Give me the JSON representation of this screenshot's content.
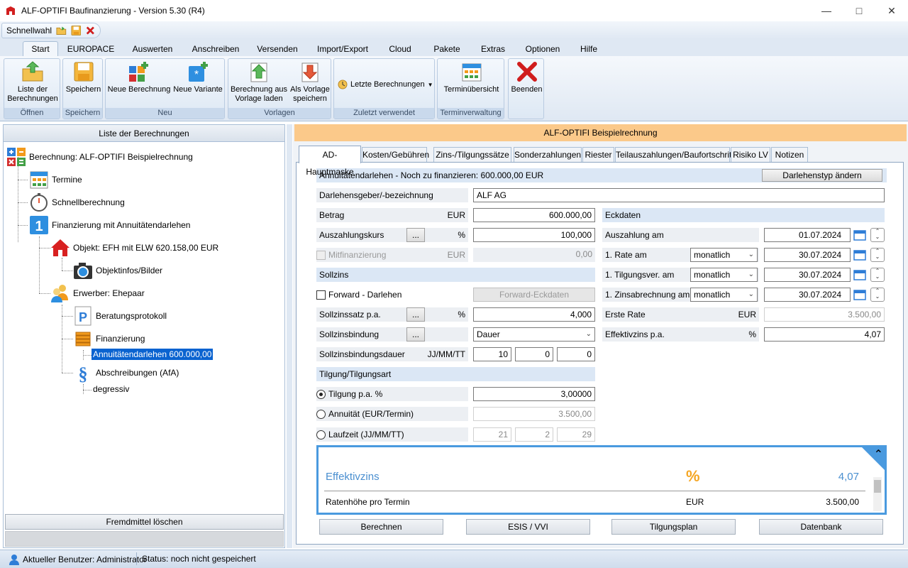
{
  "window": {
    "title": "ALF-OPTIFI Baufinanzierung - Version 5.30 (R4)"
  },
  "quick_access": {
    "label": "Schnellwahl"
  },
  "ribbon_tabs": [
    "Start",
    "EUROPACE",
    "Auswerten",
    "Anschreiben",
    "Versenden",
    "Import/Export",
    "Cloud",
    "Pakete",
    "Extras",
    "Optionen",
    "Hilfe"
  ],
  "ribbon": {
    "groups": {
      "oeffnen": "Öffnen",
      "speichern": "Speichern",
      "neu": "Neu",
      "vorlagen": "Vorlagen",
      "zuletzt": "Zuletzt verwendet",
      "termin": "Terminverwaltung"
    },
    "buttons": {
      "liste": "Liste der Berechnungen",
      "speichern": "Speichern",
      "neue_berechnung": "Neue Berechnung",
      "neue_variante": "Neue Variante",
      "vorlage_laden": "Berechnung aus Vorlage laden",
      "vorlage_speichern": "Als Vorlage speichern",
      "letzte": "Letzte Berechnungen",
      "termin": "Terminübersicht",
      "beenden": "Beenden"
    }
  },
  "left": {
    "header": "Liste der Berechnungen",
    "tree": {
      "root": "Berechnung: ALF-OPTIFI Beispielrechnung",
      "termine": "Termine",
      "schnell": "Schnellberechnung",
      "finanzierung": "Finanzierung mit Annuitätendarlehen",
      "objekt": "Objekt: EFH mit ELW 620.158,00 EUR",
      "objektinfos": "Objektinfos/Bilder",
      "erwerber": "Erwerber: Ehepaar",
      "beratung": "Beratungsprotokoll",
      "fin": "Finanzierung",
      "annuitaet": "Annuitätendarlehen 600.000,00",
      "afa": "Abschreibungen (AfA)",
      "degressiv": "degressiv"
    },
    "btn_fremdmittel": "Fremdmittel löschen"
  },
  "right": {
    "header": "ALF-OPTIFI Beispielrechnung",
    "tabs": [
      "AD-Hauptmaske",
      "Kosten/Gebühren",
      "Zins-/Tilgungssätze",
      "Sonderzahlungen",
      "Riester",
      "Teilauszahlungen/Baufortschritt",
      "Risiko LV",
      "Notizen"
    ],
    "form": {
      "top_section": "Annuitätendarlehen - Noch zu finanzieren:  600.000,00 EUR",
      "btn_darlehenstyp": "Darlehenstyp ändern",
      "darlehensgeber_label": "Darlehensgeber/-bezeichnung",
      "darlehensgeber_value": "ALF AG",
      "betrag_label": "Betrag",
      "betrag_unit": "EUR",
      "betrag_value": "600.000,00",
      "auszahlungskurs_label": "Auszahlungskurs",
      "auszahlungskurs_unit": "%",
      "auszahlungskurs_value": "100,000",
      "dots": "...",
      "mitfinanzierung_label": "Mitfinanzierung",
      "mitfinanzierung_unit": "EUR",
      "mitfinanzierung_value": "0,00",
      "sollzins_section": "Sollzins",
      "forward_label": "Forward - Darlehen",
      "btn_forward": "Forward-Eckdaten",
      "sollzinssatz_label": "Sollzinssatz p.a.",
      "sollzinssatz_unit": "%",
      "sollzinssatz_value": "4,000",
      "sollzinsbindung_label": "Sollzinsbindung",
      "sollzinsbindung_value": "Dauer",
      "sollzinsbindungsdauer_label": "Sollzinsbindungsdauer",
      "sollzinsbindungsdauer_unit": "JJ/MM/TT",
      "szb_jj": "10",
      "szb_mm": "0",
      "szb_tt": "0",
      "tilgung_section": "Tilgung/Tilgungsart",
      "tilgung_label": "Tilgung p.a. %",
      "tilgung_value": "3,00000",
      "annuitaet_label": "Annuität (EUR/Termin)",
      "annuitaet_value": "3.500,00",
      "laufzeit_label": "Laufzeit (JJ/MM/TT)",
      "lz_jj": "21",
      "lz_mm": "2",
      "lz_tt": "29",
      "eckdaten_section": "Eckdaten",
      "auszahlung_am_label": "Auszahlung am",
      "auszahlung_am_value": "01.07.2024",
      "rate_am_label": "1. Rate am",
      "rate_am_period": "monatlich",
      "rate_am_value": "30.07.2024",
      "tilgungsver_label": "1. Tilgungsver. am",
      "tilgungsver_period": "monatlich",
      "tilgungsver_value": "30.07.2024",
      "zinsabrechnung_label": "1. Zinsabrechnung am",
      "zinsabrechnung_period": "monatlich",
      "zinsabrechnung_value": "30.07.2024",
      "erste_rate_label": "Erste Rate",
      "erste_rate_unit": "EUR",
      "erste_rate_value": "3.500,00",
      "effektivzins_label": "Effektivzins p.a.",
      "effektivzins_unit": "%",
      "effektivzins_value": "4,07"
    },
    "summary": {
      "effektivzins_label": "Effektivzins",
      "effektivzins_symbol": "%",
      "effektivzins_value": "4,07",
      "ratenhoehe_label": "Ratenhöhe pro Termin",
      "ratenhoehe_unit": "EUR",
      "ratenhoehe_value": "3.500,00"
    },
    "actions": [
      "Berechnen",
      "ESIS / VVI",
      "Tilgungsplan",
      "Datenbank"
    ]
  },
  "status": {
    "user": "Aktueller Benutzer: Administrator",
    "state": "Status: noch nicht gespeichert"
  },
  "colors": {
    "ribbon_bg": "#dfe8f3",
    "header_orange": "#fbc98a",
    "section_blue": "#dbe7f5",
    "accent_blue": "#4a9adf",
    "selection": "#0a63d0"
  }
}
